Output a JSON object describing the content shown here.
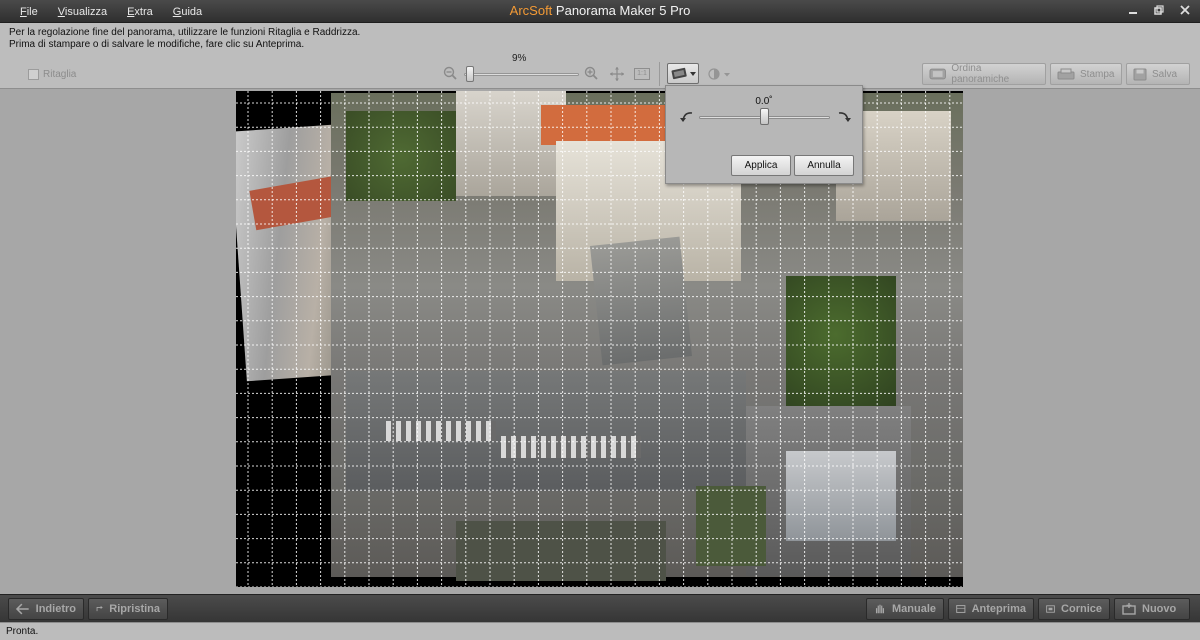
{
  "window": {
    "brand": "ArcSoft",
    "title": "Panorama Maker 5 Pro",
    "controls": [
      "minimize",
      "restore",
      "close"
    ]
  },
  "menu": [
    "File",
    "Visualizza",
    "Extra",
    "Guida"
  ],
  "info": {
    "line1": "Per la regolazione fine del panorama, utilizzare le funzioni Ritaglia e Raddrizza.",
    "line2": "Prima di stampare o di salvare le modifiche, fare clic su Anteprima."
  },
  "toolbar": {
    "crop_label": "Ritaglia",
    "crop_checked": false,
    "zoom_percent": "9%",
    "zoom_level": 0.04,
    "order_label": "Ordina panoramiche",
    "print_label": "Stampa",
    "save_label": "Salva"
  },
  "straighten_popup": {
    "angle": "0.0˚",
    "slider_level": 0.5,
    "apply_label": "Applica",
    "cancel_label": "Annulla"
  },
  "bottom": {
    "back_label": "Indietro",
    "reset_label": "Ripristina",
    "manual_label": "Manuale",
    "preview_label": "Anteprima",
    "frame_label": "Cornice",
    "new_label": "Nuovo"
  },
  "status": "Pronta.",
  "colors": {
    "brand": "#f39a35",
    "titlebar": "#3a3a3a",
    "toolbar": "#bdbdbd",
    "canvas": "#a7a7a7"
  },
  "icons": {
    "zoom_out": "zoom-out-icon",
    "zoom_in": "zoom-in-icon",
    "fit": "fit-window-icon",
    "actual": "actual-size-icon",
    "straighten": "straighten-icon",
    "brightness": "brightness-icon"
  }
}
